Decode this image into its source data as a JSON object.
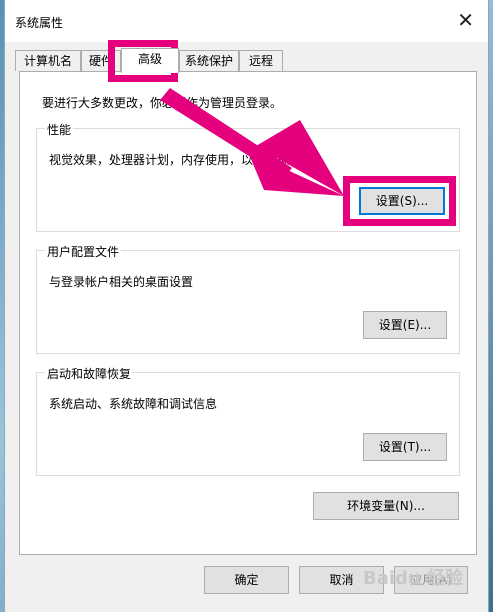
{
  "window": {
    "title": "系统属性",
    "close_glyph": "✕"
  },
  "tabs": [
    {
      "label": "计算机名"
    },
    {
      "label": "硬件"
    },
    {
      "label": "高级"
    },
    {
      "label": "系统保护"
    },
    {
      "label": "远程"
    }
  ],
  "active_tab": "高级",
  "advanced": {
    "admin_note": "要进行大多数更改，你必须作为管理员登录。",
    "performance": {
      "title": "性能",
      "description": "视觉效果，处理器计划，内存使用，以及虚拟内存",
      "button": "设置(S)..."
    },
    "user_profiles": {
      "title": "用户配置文件",
      "description": "与登录帐户相关的桌面设置",
      "button": "设置(E)..."
    },
    "startup_recovery": {
      "title": "启动和故障恢复",
      "description": "系统启动、系统故障和调试信息",
      "button": "设置(T)..."
    },
    "env_button": "环境变量(N)..."
  },
  "footer": {
    "ok": "确定",
    "cancel": "取消",
    "apply": "应用(A)"
  },
  "annotation": {
    "color": "#e5007d"
  },
  "watermark": "Baidu 经验"
}
